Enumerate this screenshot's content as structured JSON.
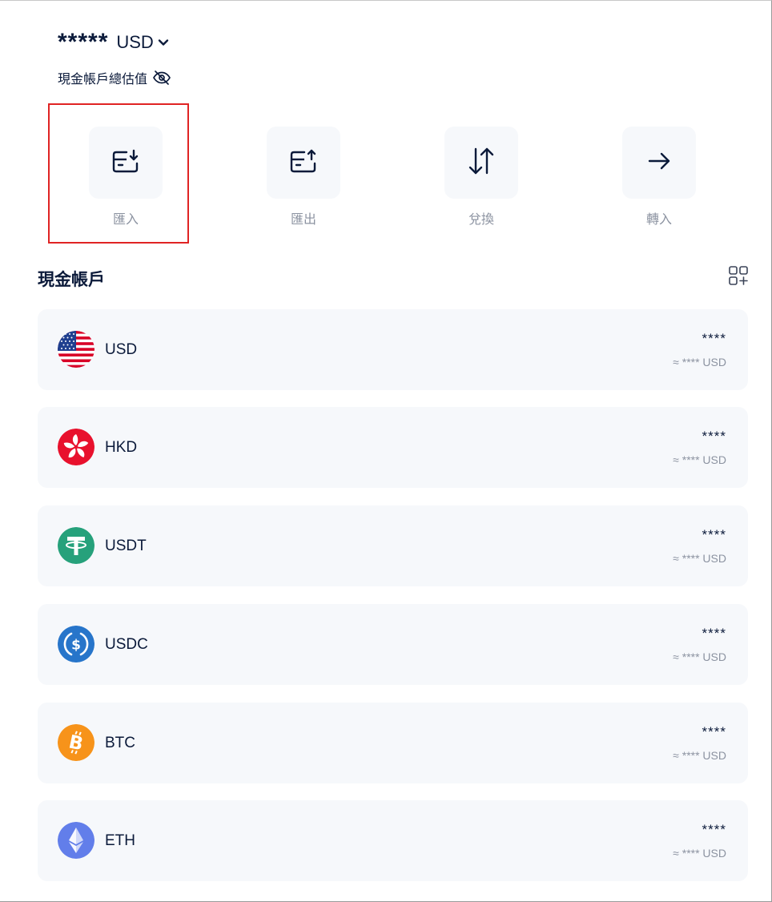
{
  "header": {
    "balance": "*****",
    "currency": "USD",
    "subtitle": "現金帳戶總估值"
  },
  "actions": [
    {
      "label": "匯入",
      "icon": "deposit-icon"
    },
    {
      "label": "匯出",
      "icon": "withdraw-icon"
    },
    {
      "label": "兌換",
      "icon": "swap-icon"
    },
    {
      "label": "轉入",
      "icon": "transfer-arrow-icon"
    }
  ],
  "section": {
    "title": "現金帳戶"
  },
  "accounts": [
    {
      "name": "USD",
      "amount": "****",
      "approx": "≈ **** USD",
      "icon": "us-flag-icon"
    },
    {
      "name": "HKD",
      "amount": "****",
      "approx": "≈ **** USD",
      "icon": "hk-flag-icon"
    },
    {
      "name": "USDT",
      "amount": "****",
      "approx": "≈ **** USD",
      "icon": "tether-icon"
    },
    {
      "name": "USDC",
      "amount": "****",
      "approx": "≈ **** USD",
      "icon": "usdc-icon"
    },
    {
      "name": "BTC",
      "amount": "****",
      "approx": "≈ **** USD",
      "icon": "bitcoin-icon"
    },
    {
      "name": "ETH",
      "amount": "****",
      "approx": "≈ **** USD",
      "icon": "ethereum-icon"
    }
  ],
  "colors": {
    "text": "#0b1a3a",
    "muted": "#8c93a1",
    "card": "#f6f8fb",
    "highlight": "#e02424"
  }
}
